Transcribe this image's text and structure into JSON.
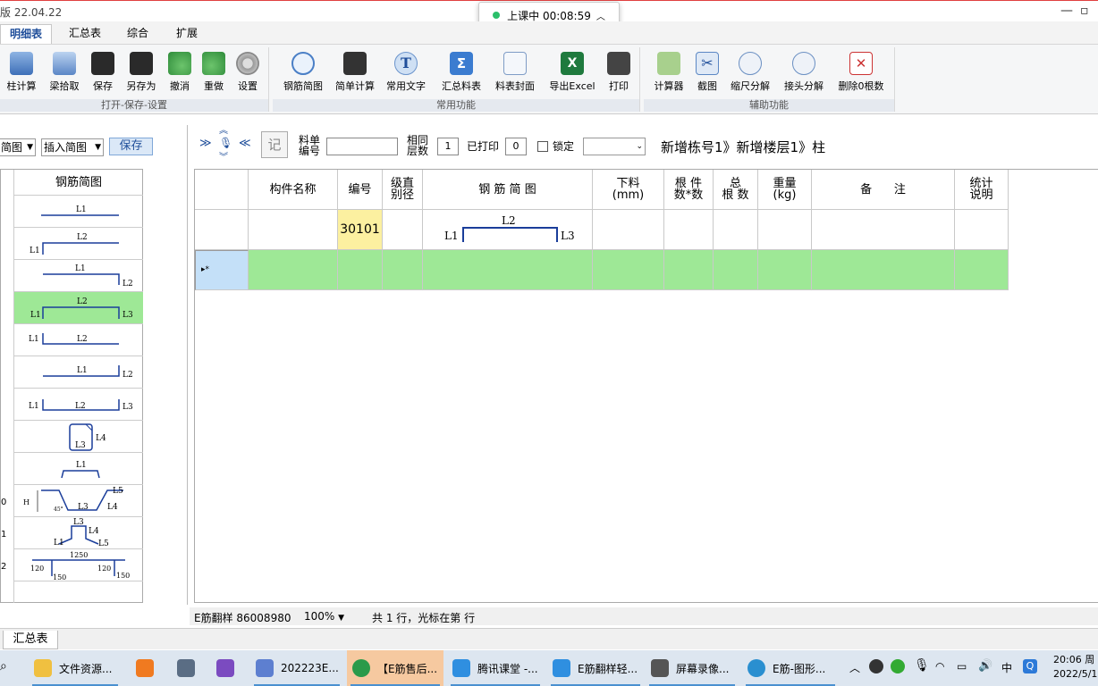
{
  "window": {
    "title_partial": "版 22.04.22"
  },
  "lesson_popup": {
    "label": "上课中 00:08:59"
  },
  "menu_tabs": [
    "明细表",
    "汇总表",
    "综合",
    "扩展"
  ],
  "ribbon": {
    "groups": [
      "打开-保存-设置",
      "常用功能",
      "辅助功能"
    ],
    "buttons": {
      "col_calc": "柱计算",
      "beam_pick": "梁拾取",
      "save": "保存",
      "save_as": "另存为",
      "undo": "撤消",
      "redo": "重做",
      "settings": "设置",
      "rebar_sketch": "钢筋简图",
      "simple_calc": "简单计算",
      "common_text": "常用文字",
      "summary_table": "汇总料表",
      "table_cover": "料表封面",
      "export_excel": "导出Excel",
      "print": "打印",
      "calculator": "计算器",
      "screenshot": "截图",
      "scale_split": "缩尺分解",
      "joint_split": "接头分解",
      "delete_zero": "删除0根数"
    }
  },
  "left_panel": {
    "select1": "简图",
    "select2": "插入简图",
    "save_label": "保存",
    "grid_header": "钢筋简图",
    "row_labels": {
      "r10": "0",
      "r11": "1",
      "r12": "2"
    },
    "shapes": {
      "s1": [
        "L1"
      ],
      "s2": [
        "L1",
        "L2"
      ],
      "s3": [
        "L1",
        "L2"
      ],
      "s4": [
        "L1",
        "L2",
        "L3"
      ],
      "s5": [
        "L1",
        "L2"
      ],
      "s6": [
        "L1",
        "L2"
      ],
      "s7": [
        "L1",
        "L2",
        "L3"
      ],
      "s8": [
        "L3",
        "L4"
      ],
      "s9": [
        "L1"
      ],
      "s10": [
        "H",
        "45°",
        "L3",
        "L4",
        "L5"
      ],
      "s11": [
        "L3",
        "L4",
        "L1",
        "L5"
      ],
      "s12": [
        "1250",
        "120",
        "120",
        "150",
        "150"
      ]
    }
  },
  "main_toolbar": {
    "label_liaodan": "料单\n编号",
    "label_xiangtong": "相同\n层数",
    "xiangtong_value": "1",
    "label_printed": "已打印",
    "printed_value": "0",
    "label_lock": "锁定",
    "breadcrumb": "新增栋号1》新增楼层1》柱",
    "record_icon_char": "记"
  },
  "grid": {
    "headers": {
      "name": "构件名称",
      "number": "编号",
      "grade": "级直\n别径",
      "sketch": "钢 筋 简 图",
      "cut": "下料\n(mm)",
      "count": "根 件\n数*数",
      "total": "总\n根 数",
      "weight": "重量\n(kg)",
      "remark": "备      注",
      "stat": "统计\n说明"
    },
    "row1": {
      "number": "30101",
      "sketch_labels": [
        "L1",
        "L2",
        "L3"
      ]
    },
    "row2": {
      "marker": "▸*"
    }
  },
  "status_bar": {
    "app": "E筋翻样 86008980",
    "zoom": "100%",
    "info": "共 1 行，光标在第  行"
  },
  "bottom_tab": "汇总表",
  "taskbar": {
    "items": [
      "文件资源...",
      "202223E...",
      "【E筋售后...",
      "腾讯课堂 -...",
      "E筋翻样轻...",
      "屏幕录像...",
      "E筋-图形..."
    ],
    "tray_ime": "中",
    "clock_time": "20:06 周",
    "clock_date": "2022/5/1"
  },
  "colors": {
    "green_row": "#9ee896",
    "yellow_cell": "#fcf0a0",
    "accent": "#1f4e9a"
  }
}
